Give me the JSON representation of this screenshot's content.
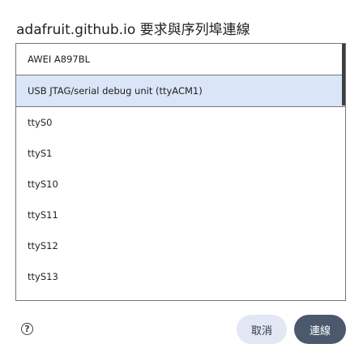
{
  "dialog": {
    "title": "adafruit.github.io 要求與序列埠連線"
  },
  "ports": [
    {
      "label": "AWEI A897BL",
      "selected": false
    },
    {
      "label": "USB JTAG/serial debug unit (ttyACM1)",
      "selected": true
    },
    {
      "label": "ttyS0",
      "selected": false
    },
    {
      "label": "ttyS1",
      "selected": false
    },
    {
      "label": "ttyS10",
      "selected": false
    },
    {
      "label": "ttyS11",
      "selected": false
    },
    {
      "label": "ttyS12",
      "selected": false
    },
    {
      "label": "ttyS13",
      "selected": false
    }
  ],
  "footer": {
    "help_icon": "help-circle-icon",
    "help_glyph": "?",
    "cancel_label": "取消",
    "connect_label": "連線"
  },
  "colors": {
    "selected_bg": "#dbe5f8",
    "border": "#747775",
    "connect_bg": "#4b586e",
    "cancel_bg": "#e2e7f3"
  }
}
